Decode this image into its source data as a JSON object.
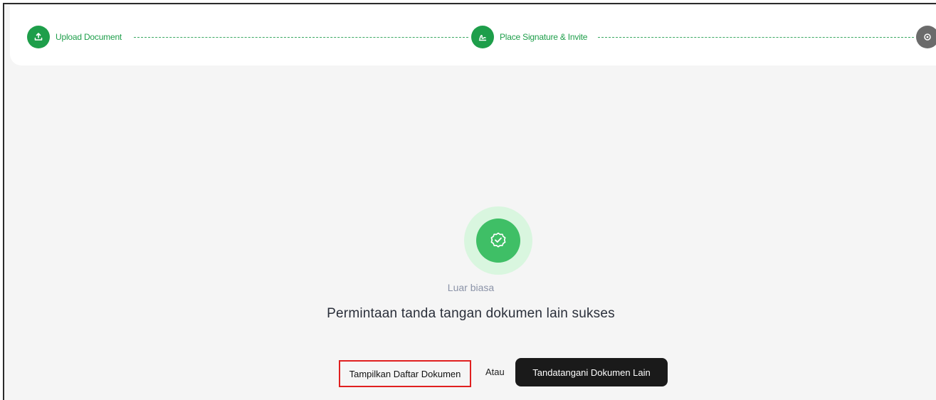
{
  "stepper": {
    "steps": [
      {
        "label": "Upload Document",
        "state": "complete",
        "icon": "upload-icon"
      },
      {
        "label": "Place Signature & Invite",
        "state": "complete",
        "icon": "signature-icon"
      },
      {
        "label": "",
        "state": "pending",
        "icon": "settings-icon"
      }
    ],
    "colors": {
      "active": "#1e9e4a",
      "inactive": "#6b6b6b",
      "line": "#3aa862"
    }
  },
  "success": {
    "icon": "verified-check-icon",
    "subtitle": "Luar biasa",
    "title": "Permintaan tanda tangan dokumen lain sukses"
  },
  "actions": {
    "view_documents_label": "Tampilkan Daftar Dokumen",
    "or_label": "Atau",
    "sign_other_label": "Tandatangani Dokumen Lain"
  }
}
